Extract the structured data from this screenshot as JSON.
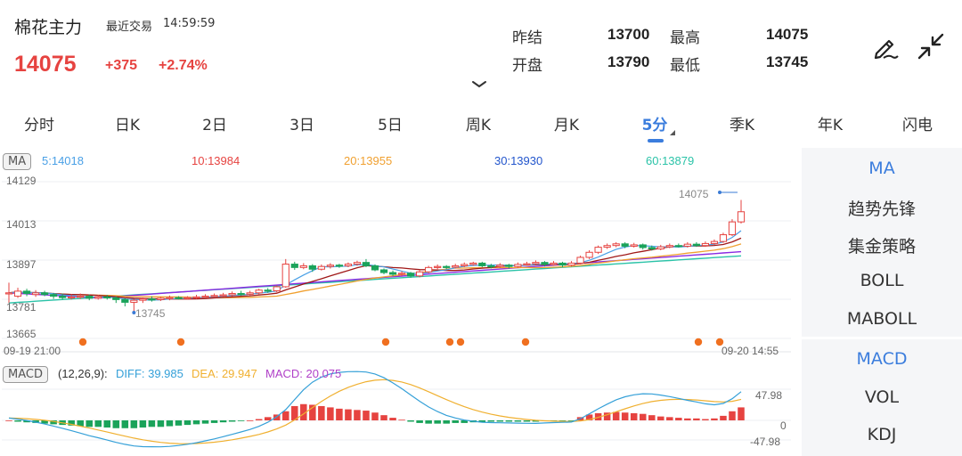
{
  "header": {
    "name": "棉花主力",
    "latest_label": "最近交易",
    "latest_time": "14:59:59",
    "price": "14075",
    "change": "+375",
    "change_pct": "+2.74%",
    "stats": {
      "prev_settle_label": "昨结",
      "prev_settle": "13700",
      "high_label": "最高",
      "high": "14075",
      "open_label": "开盘",
      "open": "13790",
      "low_label": "最低",
      "low": "13745"
    },
    "icons": [
      "draw-icon",
      "collapse-icon",
      "chevron-down-icon"
    ]
  },
  "tabs": [
    "分时",
    "日K",
    "2日",
    "3日",
    "5日",
    "周K",
    "月K",
    "5分",
    "季K",
    "年K",
    "闪电"
  ],
  "active_tab": "5分",
  "ma": {
    "tag": "MA",
    "ma5": "5:14018",
    "ma10": "10:13984",
    "ma20": "20:13955",
    "ma30": "30:13930",
    "ma60": "60:13879"
  },
  "price_axis": {
    "ticks": [
      "14129",
      "14013",
      "13897",
      "13781",
      "13665"
    ],
    "max_label": "14075",
    "min_label": "13745",
    "start_time": "09-19 21:00",
    "end_time": "09-20 14:55"
  },
  "macd": {
    "tag": "MACD",
    "params": "(12,26,9):",
    "diff": "DIFF: 39.985",
    "dea": "DEA: 29.947",
    "macd": "MACD: 20.075",
    "ticks": [
      "47.98",
      "0",
      "-47.98"
    ]
  },
  "panel": {
    "main": [
      "MA",
      "趋势先锋",
      "集金策略",
      "BOLL",
      "MABOLL"
    ],
    "sub": [
      "MACD",
      "VOL",
      "KDJ"
    ]
  },
  "colors": {
    "up": "#e64340",
    "down": "#1aa35a",
    "accent": "#3b7ddd",
    "ma5": "#4aa0e6",
    "ma10": "#e64340",
    "ma20": "#f0a030",
    "ma30": "#2255cc",
    "ma60": "#2bc3a8",
    "diff": "#35a0d8",
    "dea": "#f0b030",
    "macd_label": "#b040c8",
    "ma_line_dark": "#a01818",
    "ma_line_purple": "#8a2be2"
  },
  "chart_data": {
    "type": "candlestick",
    "price_range": [
      13665,
      14129
    ],
    "candles": [
      [
        13800,
        13800,
        13830,
        13770
      ],
      [
        13790,
        13805,
        13815,
        13785
      ],
      [
        13805,
        13798,
        13812,
        13790
      ],
      [
        13795,
        13800,
        13808,
        13788
      ],
      [
        13800,
        13795,
        13806,
        13790
      ],
      [
        13795,
        13790,
        13800,
        13782
      ],
      [
        13790,
        13786,
        13798,
        13780
      ],
      [
        13786,
        13788,
        13796,
        13780
      ],
      [
        13788,
        13790,
        13798,
        13782
      ],
      [
        13790,
        13784,
        13795,
        13778
      ],
      [
        13784,
        13788,
        13794,
        13780
      ],
      [
        13788,
        13785,
        13794,
        13780
      ],
      [
        13785,
        13780,
        13790,
        13770
      ],
      [
        13780,
        13772,
        13784,
        13760
      ],
      [
        13772,
        13778,
        13782,
        13745
      ],
      [
        13778,
        13782,
        13786,
        13770
      ],
      [
        13782,
        13780,
        13790,
        13774
      ],
      [
        13780,
        13784,
        13788,
        13776
      ],
      [
        13784,
        13786,
        13792,
        13778
      ],
      [
        13786,
        13784,
        13790,
        13780
      ],
      [
        13784,
        13786,
        13790,
        13780
      ],
      [
        13786,
        13788,
        13794,
        13782
      ],
      [
        13788,
        13790,
        13796,
        13784
      ],
      [
        13790,
        13792,
        13798,
        13786
      ],
      [
        13792,
        13794,
        13800,
        13788
      ],
      [
        13794,
        13798,
        13804,
        13790
      ],
      [
        13798,
        13796,
        13806,
        13792
      ],
      [
        13796,
        13800,
        13806,
        13792
      ],
      [
        13800,
        13808,
        13812,
        13796
      ],
      [
        13808,
        13806,
        13814,
        13800
      ],
      [
        13806,
        13818,
        13822,
        13802
      ],
      [
        13818,
        13885,
        13900,
        13815
      ],
      [
        13885,
        13875,
        13892,
        13868
      ],
      [
        13875,
        13880,
        13888,
        13870
      ],
      [
        13880,
        13870,
        13885,
        13862
      ],
      [
        13870,
        13878,
        13884,
        13866
      ],
      [
        13878,
        13882,
        13888,
        13872
      ],
      [
        13882,
        13880,
        13886,
        13874
      ],
      [
        13880,
        13885,
        13890,
        13876
      ],
      [
        13885,
        13890,
        13895,
        13880
      ],
      [
        13890,
        13880,
        13900,
        13876
      ],
      [
        13880,
        13868,
        13884,
        13864
      ],
      [
        13868,
        13860,
        13872,
        13855
      ],
      [
        13860,
        13855,
        13866,
        13850
      ],
      [
        13855,
        13858,
        13864,
        13850
      ],
      [
        13858,
        13850,
        13862,
        13845
      ],
      [
        13850,
        13862,
        13868,
        13846
      ],
      [
        13862,
        13875,
        13880,
        13858
      ],
      [
        13875,
        13878,
        13884,
        13870
      ],
      [
        13878,
        13876,
        13882,
        13870
      ],
      [
        13876,
        13880,
        13886,
        13872
      ],
      [
        13880,
        13884,
        13890,
        13876
      ],
      [
        13884,
        13888,
        13892,
        13880
      ],
      [
        13888,
        13880,
        13892,
        13876
      ],
      [
        13880,
        13878,
        13886,
        13872
      ],
      [
        13878,
        13882,
        13888,
        13874
      ],
      [
        13882,
        13878,
        13886,
        13872
      ],
      [
        13878,
        13884,
        13890,
        13874
      ],
      [
        13884,
        13886,
        13892,
        13880
      ],
      [
        13886,
        13890,
        13896,
        13882
      ],
      [
        13890,
        13884,
        13894,
        13878
      ],
      [
        13884,
        13888,
        13894,
        13880
      ],
      [
        13888,
        13882,
        13892,
        13876
      ],
      [
        13882,
        13888,
        13894,
        13878
      ],
      [
        13888,
        13905,
        13910,
        13884
      ],
      [
        13905,
        13920,
        13926,
        13900
      ],
      [
        13920,
        13935,
        13940,
        13915
      ],
      [
        13935,
        13940,
        13946,
        13930
      ],
      [
        13940,
        13945,
        13950,
        13935
      ],
      [
        13945,
        13938,
        13950,
        13932
      ],
      [
        13938,
        13942,
        13948,
        13934
      ],
      [
        13942,
        13934,
        13946,
        13928
      ],
      [
        13934,
        13930,
        13940,
        13925
      ],
      [
        13930,
        13936,
        13942,
        13926
      ],
      [
        13936,
        13940,
        13946,
        13932
      ],
      [
        13940,
        13938,
        13946,
        13934
      ],
      [
        13938,
        13944,
        13950,
        13934
      ],
      [
        13944,
        13940,
        13950,
        13936
      ],
      [
        13940,
        13946,
        13952,
        13936
      ],
      [
        13946,
        13952,
        13958,
        13942
      ],
      [
        13952,
        13972,
        13978,
        13948
      ],
      [
        13972,
        14010,
        14018,
        13968
      ],
      [
        14010,
        14040,
        14075,
        14005
      ]
    ],
    "macd_hist": [
      0,
      -2,
      -3,
      -4,
      -5,
      -6,
      -7,
      -8,
      -9,
      -10,
      -10,
      -11,
      -12,
      -12,
      -12,
      -11,
      -10,
      -10,
      -9,
      -8,
      -7,
      -6,
      -5,
      -4,
      -3,
      -2,
      -1,
      0,
      2,
      5,
      9,
      14,
      22,
      25,
      24,
      22,
      20,
      18,
      17,
      16,
      15,
      12,
      8,
      4,
      1,
      -2,
      -4,
      -5,
      -5,
      -5,
      -4,
      -4,
      -3,
      -3,
      -2,
      -2,
      -2,
      -2,
      -2,
      -2,
      -1,
      -1,
      -1,
      -1,
      5,
      9,
      11,
      12,
      13,
      12,
      11,
      10,
      8,
      6,
      5,
      4,
      3,
      3,
      2,
      3,
      7,
      14,
      20
    ]
  }
}
